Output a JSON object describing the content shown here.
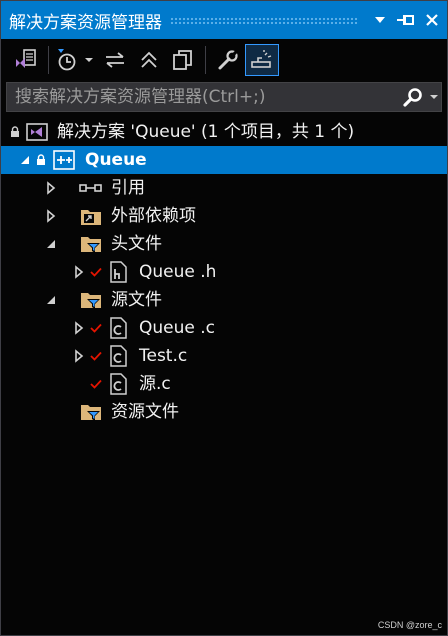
{
  "window": {
    "title": "解决方案资源管理器"
  },
  "search": {
    "placeholder": "搜索解决方案资源管理器(Ctrl+;)"
  },
  "tree": {
    "solution": {
      "label": "解决方案 'Queue' (1 个项目，共 1 个)"
    },
    "project": {
      "label": "Queue"
    },
    "references": {
      "label": "引用"
    },
    "external_deps": {
      "label": "外部依赖项"
    },
    "header_files": {
      "label": "头文件"
    },
    "queue_h": {
      "label": "Queue .h"
    },
    "source_files": {
      "label": "源文件"
    },
    "queue_c": {
      "label": "Queue .c"
    },
    "test_c": {
      "label": "Test.c"
    },
    "yuan_c": {
      "label": "源.c"
    },
    "resource_files": {
      "label": "资源文件"
    }
  },
  "watermark": {
    "text": "CSDN @zore_c"
  },
  "colors": {
    "accent": "#007acc",
    "background": "#050505",
    "folder": "#dcb67a",
    "check": "#e51400",
    "vs_purple": "#b180d7"
  },
  "icons": [
    "vs-solution-icon",
    "history-icon",
    "sync-icon",
    "collapse-all-icon",
    "copy-icon",
    "wrench-icon",
    "preview-icon",
    "search-icon",
    "pin-icon",
    "close-icon",
    "lock-icon",
    "cpp-project-icon",
    "references-icon",
    "external-deps-icon",
    "filter-folder-icon",
    "header-file-icon",
    "c-file-icon",
    "checkmark-icon"
  ]
}
